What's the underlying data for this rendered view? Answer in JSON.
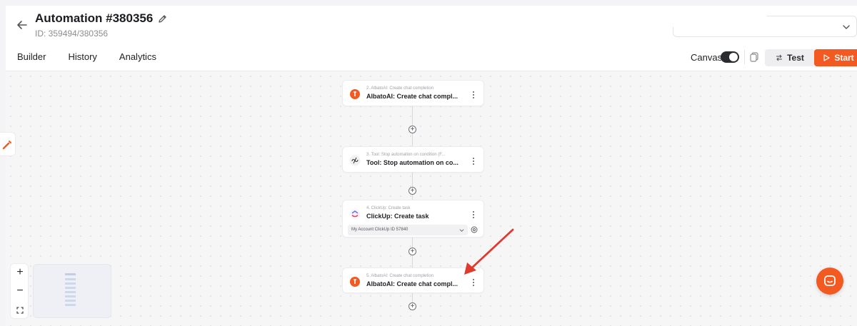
{
  "header": {
    "title": "Automation #380356",
    "id_text": "ID: 359494/380356",
    "select_placeholder": ""
  },
  "tabs": [
    "Builder",
    "History",
    "Analytics"
  ],
  "toolbar": {
    "canvas_label": "Canvas",
    "canvas_toggle_on": true,
    "test_label": "Test",
    "start_label": "Start"
  },
  "steps": [
    {
      "subtitle": "2. AlbatoAI: Create chat completion",
      "title": "AlbatoAI: Create chat compl...",
      "icon": "albato-ai-icon"
    },
    {
      "subtitle": "3. Tool: Stop automation on condition (F...",
      "title": "Tool: Stop automation on co...",
      "icon": "tool-icon"
    },
    {
      "subtitle": "4. ClickUp: Create task",
      "title": "ClickUp: Create task",
      "icon": "clickup-icon",
      "account": "My Account ClickUp ID 57840"
    },
    {
      "subtitle": "5. AlbatoAI: Create chat completion",
      "title": "AlbatoAI: Create chat compl...",
      "icon": "albato-ai-icon"
    }
  ],
  "zoom_controls": {
    "zoom_in": "+",
    "zoom_out": "−"
  },
  "colors": {
    "accent": "#f25a22",
    "annotation_arrow": "#e03a2f",
    "toggle_on": "#2a2b30"
  }
}
